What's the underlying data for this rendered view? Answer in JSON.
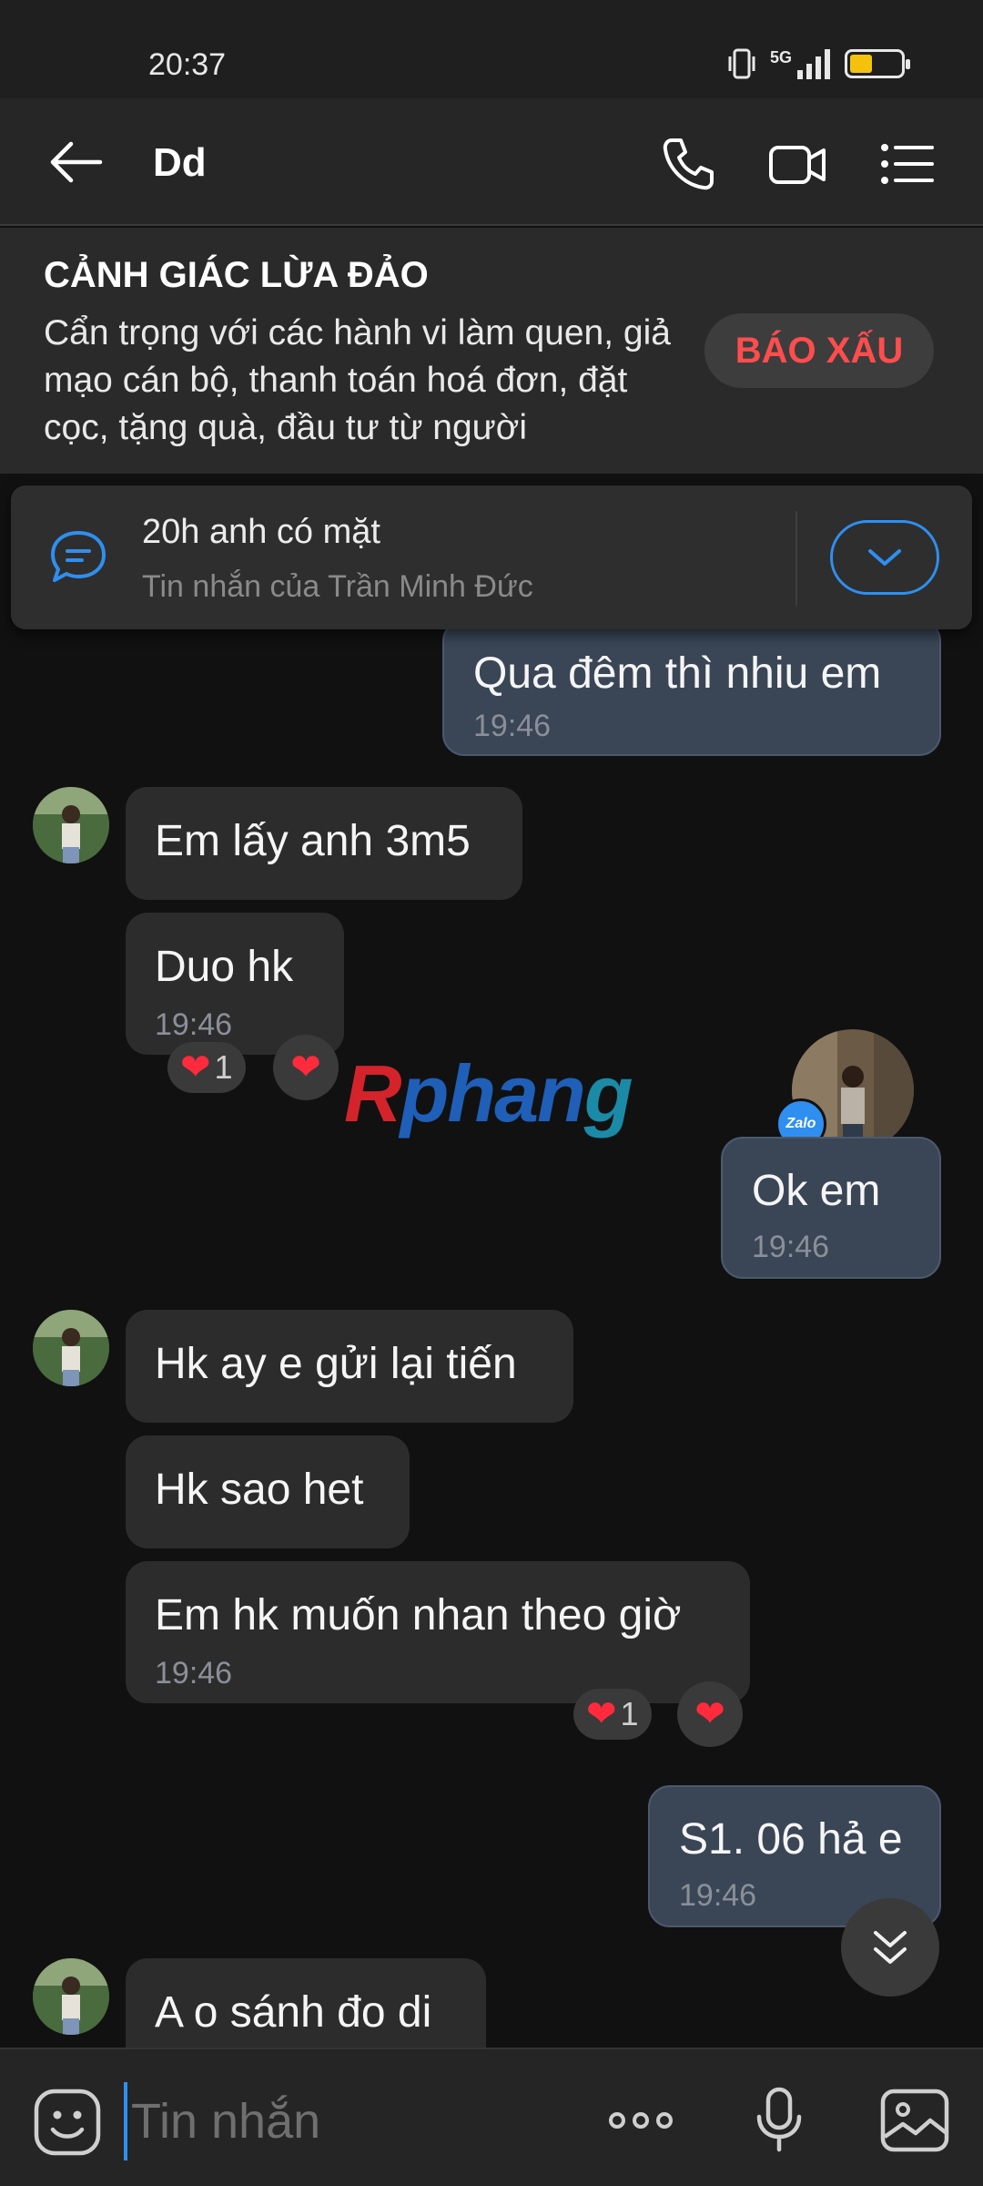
{
  "status_bar": {
    "time": "20:37",
    "network": "5G",
    "battery_level": 0.45,
    "battery_color": "#f4c20d"
  },
  "header": {
    "title": "Dd",
    "icons": [
      "back-arrow-icon",
      "phone-icon",
      "video-icon",
      "menu-icon"
    ]
  },
  "warning": {
    "title": "CẢNH GIÁC LỪA ĐẢO",
    "body": "Cẩn trọng với các hành vi làm quen, giả mạo cán bộ, thanh toán hoá đơn, đặt cọc, tặng quà, đầu tư từ người",
    "report_label": "BÁO XẤU",
    "report_color": "#ff4d4d"
  },
  "pinned": {
    "title": "20h anh có mặt",
    "subtitle": "Tin nhắn của Trần Minh Đức"
  },
  "messages": [
    {
      "dir": "out",
      "text": "Qua đêm thì nhiu em",
      "time": "19:46"
    },
    {
      "dir": "in",
      "text": "Em lấy anh 3m5"
    },
    {
      "dir": "in",
      "text": "Duo hk",
      "time": "19:46",
      "reaction_count": "1"
    },
    {
      "dir": "out",
      "text": "Ok em",
      "time": "19:46"
    },
    {
      "dir": "in",
      "text": "Hk ay e gửi lại tiến"
    },
    {
      "dir": "in",
      "text": "Hk sao het"
    },
    {
      "dir": "in",
      "text": "Em hk muốn nhan theo giờ",
      "time": "19:46",
      "reaction_count": "1"
    },
    {
      "dir": "out",
      "text": "S1. 06 hả e",
      "time": "19:46"
    },
    {
      "dir": "in",
      "text": "A o sánh đo di"
    }
  ],
  "seen_badge": "Zalo",
  "watermark": {
    "part1": "R",
    "part2": "phan",
    "part3": "g"
  },
  "composer": {
    "placeholder": "Tin nhắn",
    "icons": [
      "emoji-icon",
      "more-icon",
      "microphone-icon",
      "image-icon"
    ]
  },
  "colors": {
    "accent": "#2f8ff0",
    "outgoing_bubble": "#3a4656",
    "incoming_bubble": "#2c2c2c",
    "heart": "#ff2b3d"
  }
}
